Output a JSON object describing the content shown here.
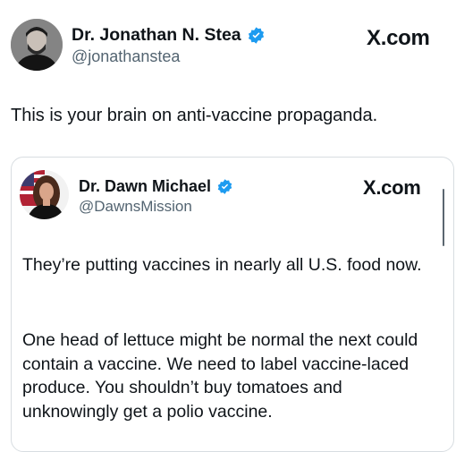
{
  "outer_post": {
    "author_name": "Dr. Jonathan N. Stea",
    "handle": "@jonathanstea",
    "brand": "X.com",
    "text": "This is your brain on anti-vaccine propaganda."
  },
  "quoted_post": {
    "author_name": "Dr. Dawn Michael",
    "handle": "@DawnsMission",
    "brand": "X.com",
    "paragraphs": [
      "They’re putting vaccines in nearly all U.S. food now.",
      "One head of lettuce might be normal the next could contain a vaccine. We need to label vaccine-laced produce. You shouldn’t buy tomatoes and unknowingly get a polio vaccine."
    ]
  },
  "colors": {
    "verified": "#1d9bf0",
    "text": "#0f1419",
    "muted": "#536471",
    "border": "#d8dde1"
  },
  "icons": {
    "verified": "verified-badge-icon",
    "brand": "x-logo-icon"
  }
}
